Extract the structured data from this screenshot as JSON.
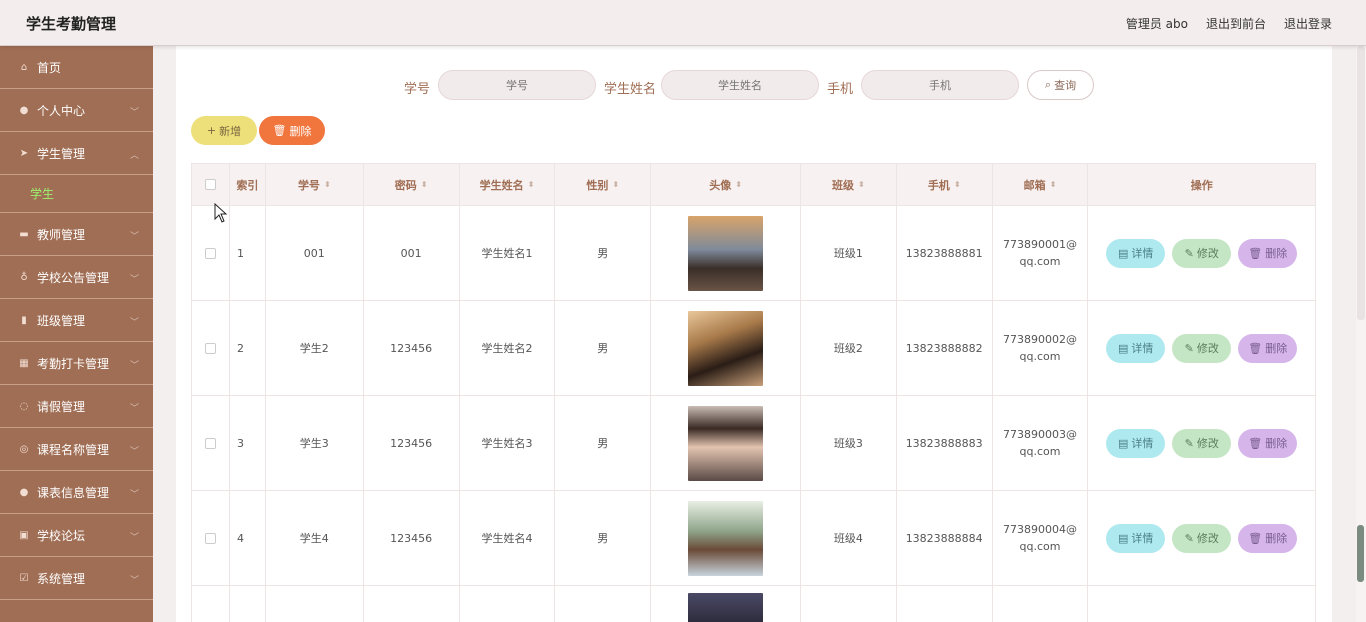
{
  "app": {
    "title": "学生考勤管理"
  },
  "top_links": [
    "管理员 abo",
    "退出到前台",
    "退出登录"
  ],
  "sidebar": {
    "items": [
      {
        "label": "首页",
        "icon": "home-icon",
        "has_chevron": false
      },
      {
        "label": "个人中心",
        "icon": "user-icon",
        "has_chevron": true
      },
      {
        "label": "学生管理",
        "icon": "send-icon",
        "has_chevron": true,
        "expanded": true,
        "sub": "学生"
      },
      {
        "label": "教师管理",
        "icon": "chat-icon",
        "has_chevron": true
      },
      {
        "label": "学校公告管理",
        "icon": "location-icon",
        "has_chevron": true
      },
      {
        "label": "班级管理",
        "icon": "chart-icon",
        "has_chevron": true
      },
      {
        "label": "考勤打卡管理",
        "icon": "calendar-icon",
        "has_chevron": true
      },
      {
        "label": "请假管理",
        "icon": "leave-icon",
        "has_chevron": true
      },
      {
        "label": "课程名称管理",
        "icon": "compass-icon",
        "has_chevron": true
      },
      {
        "label": "课表信息管理",
        "icon": "bulb-icon",
        "has_chevron": true
      },
      {
        "label": "学校论坛",
        "icon": "forum-icon",
        "has_chevron": true
      },
      {
        "label": "系统管理",
        "icon": "system-icon",
        "has_chevron": true
      }
    ]
  },
  "search": {
    "label_no": "学号",
    "placeholder_no": "学号",
    "label_name": "学生姓名",
    "placeholder_name": "学生姓名",
    "label_phone": "手机",
    "placeholder_phone": "手机",
    "button": "查询"
  },
  "toolbar": {
    "add": "新增",
    "delete": "删除"
  },
  "table": {
    "headers": {
      "index": "索引",
      "no": "学号",
      "password": "密码",
      "name": "学生姓名",
      "sex": "性别",
      "avatar": "头像",
      "class": "班级",
      "phone": "手机",
      "email": "邮箱",
      "ops": "操作"
    },
    "rows": [
      {
        "index": "1",
        "no": "001",
        "password": "001",
        "name": "学生姓名1",
        "sex": "男",
        "class": "班级1",
        "phone": "13823888881",
        "email": "773890001@qq.com"
      },
      {
        "index": "2",
        "no": "学生2",
        "password": "123456",
        "name": "学生姓名2",
        "sex": "男",
        "class": "班级2",
        "phone": "13823888882",
        "email": "773890002@qq.com"
      },
      {
        "index": "3",
        "no": "学生3",
        "password": "123456",
        "name": "学生姓名3",
        "sex": "男",
        "class": "班级3",
        "phone": "13823888883",
        "email": "773890003@qq.com"
      },
      {
        "index": "4",
        "no": "学生4",
        "password": "123456",
        "name": "学生姓名4",
        "sex": "男",
        "class": "班级4",
        "phone": "13823888884",
        "email": "773890004@qq.com"
      }
    ],
    "row_actions": {
      "detail": "详情",
      "edit": "修改",
      "delete": "删除"
    }
  },
  "colors": {
    "sidebar": "#a06e54",
    "accent": "#a06e54",
    "sub_active": "#9bf26e"
  }
}
